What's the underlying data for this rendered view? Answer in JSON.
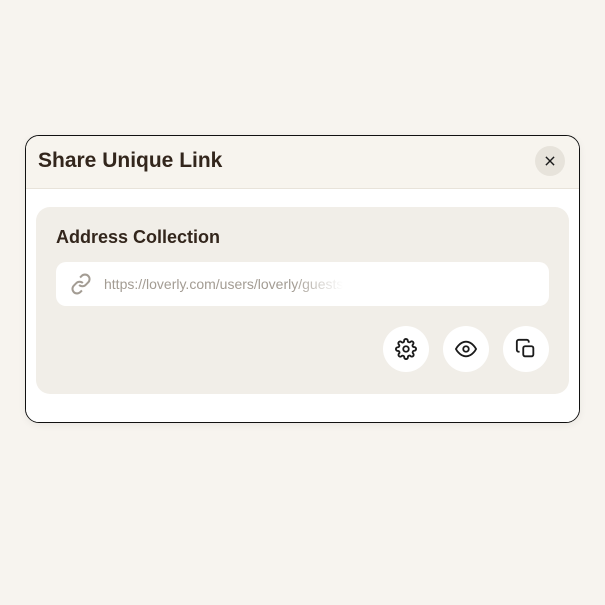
{
  "modal": {
    "title": "Share Unique Link",
    "card": {
      "title": "Address Collection",
      "url": "https://loverly.com/users/loverly/guests"
    }
  }
}
